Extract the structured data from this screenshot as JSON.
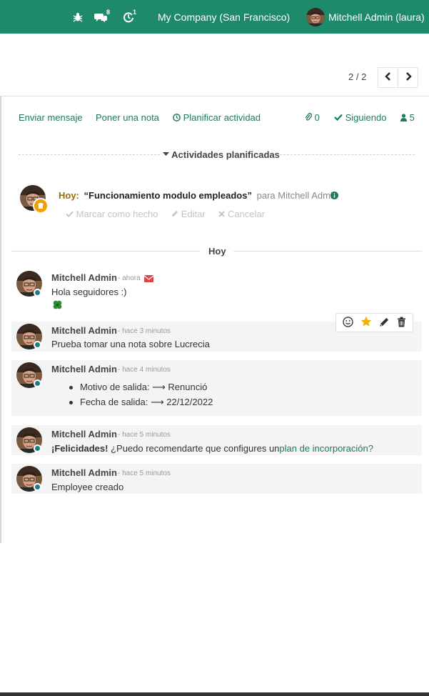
{
  "topbar": {
    "messages_count": "8",
    "activities_count": "1",
    "company": "My Company (San Francisco)",
    "user": "Mitchell Admin (laura)"
  },
  "pager": {
    "value": "2 / 2"
  },
  "chatter": {
    "send_message": "Enviar mensaje",
    "log_note": "Poner una nota",
    "schedule_activity": "Planificar actividad",
    "attachments_count": "0",
    "following": "Siguiendo",
    "followers_count": "5"
  },
  "activities": {
    "header": "Actividades planificadas",
    "due": "Hoy:",
    "summary": "“Funcionamiento modulo empleados”",
    "assigned": "para Mitchell Admin",
    "mark_done": "Marcar como hecho",
    "edit": "Editar",
    "cancel": "Cancelar"
  },
  "today_sep": "Hoy",
  "messages": [
    {
      "author": "Mitchell Admin",
      "date": "- ahora",
      "body": "Hola seguidores :)"
    },
    {
      "author": "Mitchell Admin",
      "date": "- hace 3 minutos",
      "body": "Prueba tomar una nota sobre Lucrecia"
    },
    {
      "author": "Mitchell Admin",
      "date": "- hace 4 minutos",
      "tracking": [
        "Motivo de salida: ⟶ Renunció",
        "Fecha de salida: ⟶ 22/12/2022"
      ]
    },
    {
      "author": "Mitchell Admin",
      "date": "- hace 5 minutos",
      "body_bold": "¡Felicidades!",
      "body": " ¿Puedo recomendarte que configures un",
      "link": "plan de incorporación?"
    },
    {
      "author": "Mitchell Admin",
      "date": "- hace 5 minutos",
      "body": "Employee creado"
    }
  ],
  "colors": {
    "brand": "#1d8a6a",
    "link": "#1d7a5c",
    "due_today": "#9a6b00",
    "status": "#17808d"
  }
}
